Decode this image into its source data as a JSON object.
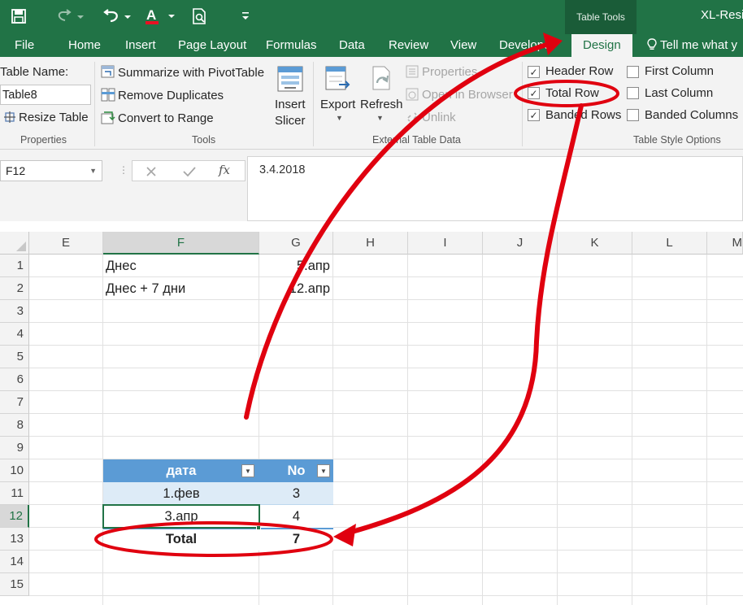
{
  "app": {
    "title": "XL-Resiz",
    "context_header": "Table Tools"
  },
  "tabs": [
    {
      "label": "File"
    },
    {
      "label": "Home"
    },
    {
      "label": "Insert"
    },
    {
      "label": "Page Layout"
    },
    {
      "label": "Formulas"
    },
    {
      "label": "Data"
    },
    {
      "label": "Review"
    },
    {
      "label": "View"
    },
    {
      "label": "Developer"
    },
    {
      "label": "Design"
    }
  ],
  "tell_me": "Tell me what y",
  "ribbon": {
    "properties": {
      "table_name_label": "Table Name:",
      "table_name_value": "Table8",
      "resize_table": "Resize Table",
      "group_label": "Properties"
    },
    "tools": {
      "summarize": "Summarize with PivotTable",
      "remove_duplicates": "Remove Duplicates",
      "convert_to_range": "Convert to Range",
      "insert_slicer_line1": "Insert",
      "insert_slicer_line2": "Slicer",
      "group_label": "Tools"
    },
    "external": {
      "export": "Export",
      "refresh": "Refresh",
      "properties": "Properties",
      "open_in_browser": "Open in Browser",
      "unlink": "Unlink",
      "group_label": "External Table Data"
    },
    "style_options": {
      "header_row": "Header Row",
      "total_row": "Total Row",
      "banded_rows": "Banded Rows",
      "first_column": "First Column",
      "last_column": "Last Column",
      "banded_columns": "Banded Columns",
      "header_row_checked": true,
      "total_row_checked": true,
      "banded_rows_checked": true,
      "first_column_checked": false,
      "last_column_checked": false,
      "banded_columns_checked": false,
      "group_label": "Table Style Options"
    }
  },
  "formula_bar": {
    "name_box": "F12",
    "value": "3.4.2018"
  },
  "grid": {
    "columns": [
      "E",
      "F",
      "G",
      "H",
      "I",
      "J",
      "K",
      "L",
      "M"
    ],
    "selected_column": "F",
    "rows": [
      "1",
      "2",
      "3",
      "4",
      "5",
      "6",
      "7",
      "8",
      "9",
      "10",
      "11",
      "12",
      "13",
      "14",
      "15"
    ],
    "selected_row": "12",
    "cells": {
      "F1": "Днес",
      "G1": "5.апр",
      "F2": "Днес + 7 дни",
      "G2": "12.апр"
    },
    "table": {
      "header": [
        "дата",
        "No"
      ],
      "rows": [
        [
          "1.фев",
          "3"
        ],
        [
          "3.апр",
          "4"
        ]
      ],
      "total_label": "Total",
      "total_value": "7"
    }
  },
  "colors": {
    "excel_green": "#217346",
    "table_header": "#5b9bd5",
    "table_band": "#ddebf7",
    "annotation_red": "#e0000f"
  }
}
